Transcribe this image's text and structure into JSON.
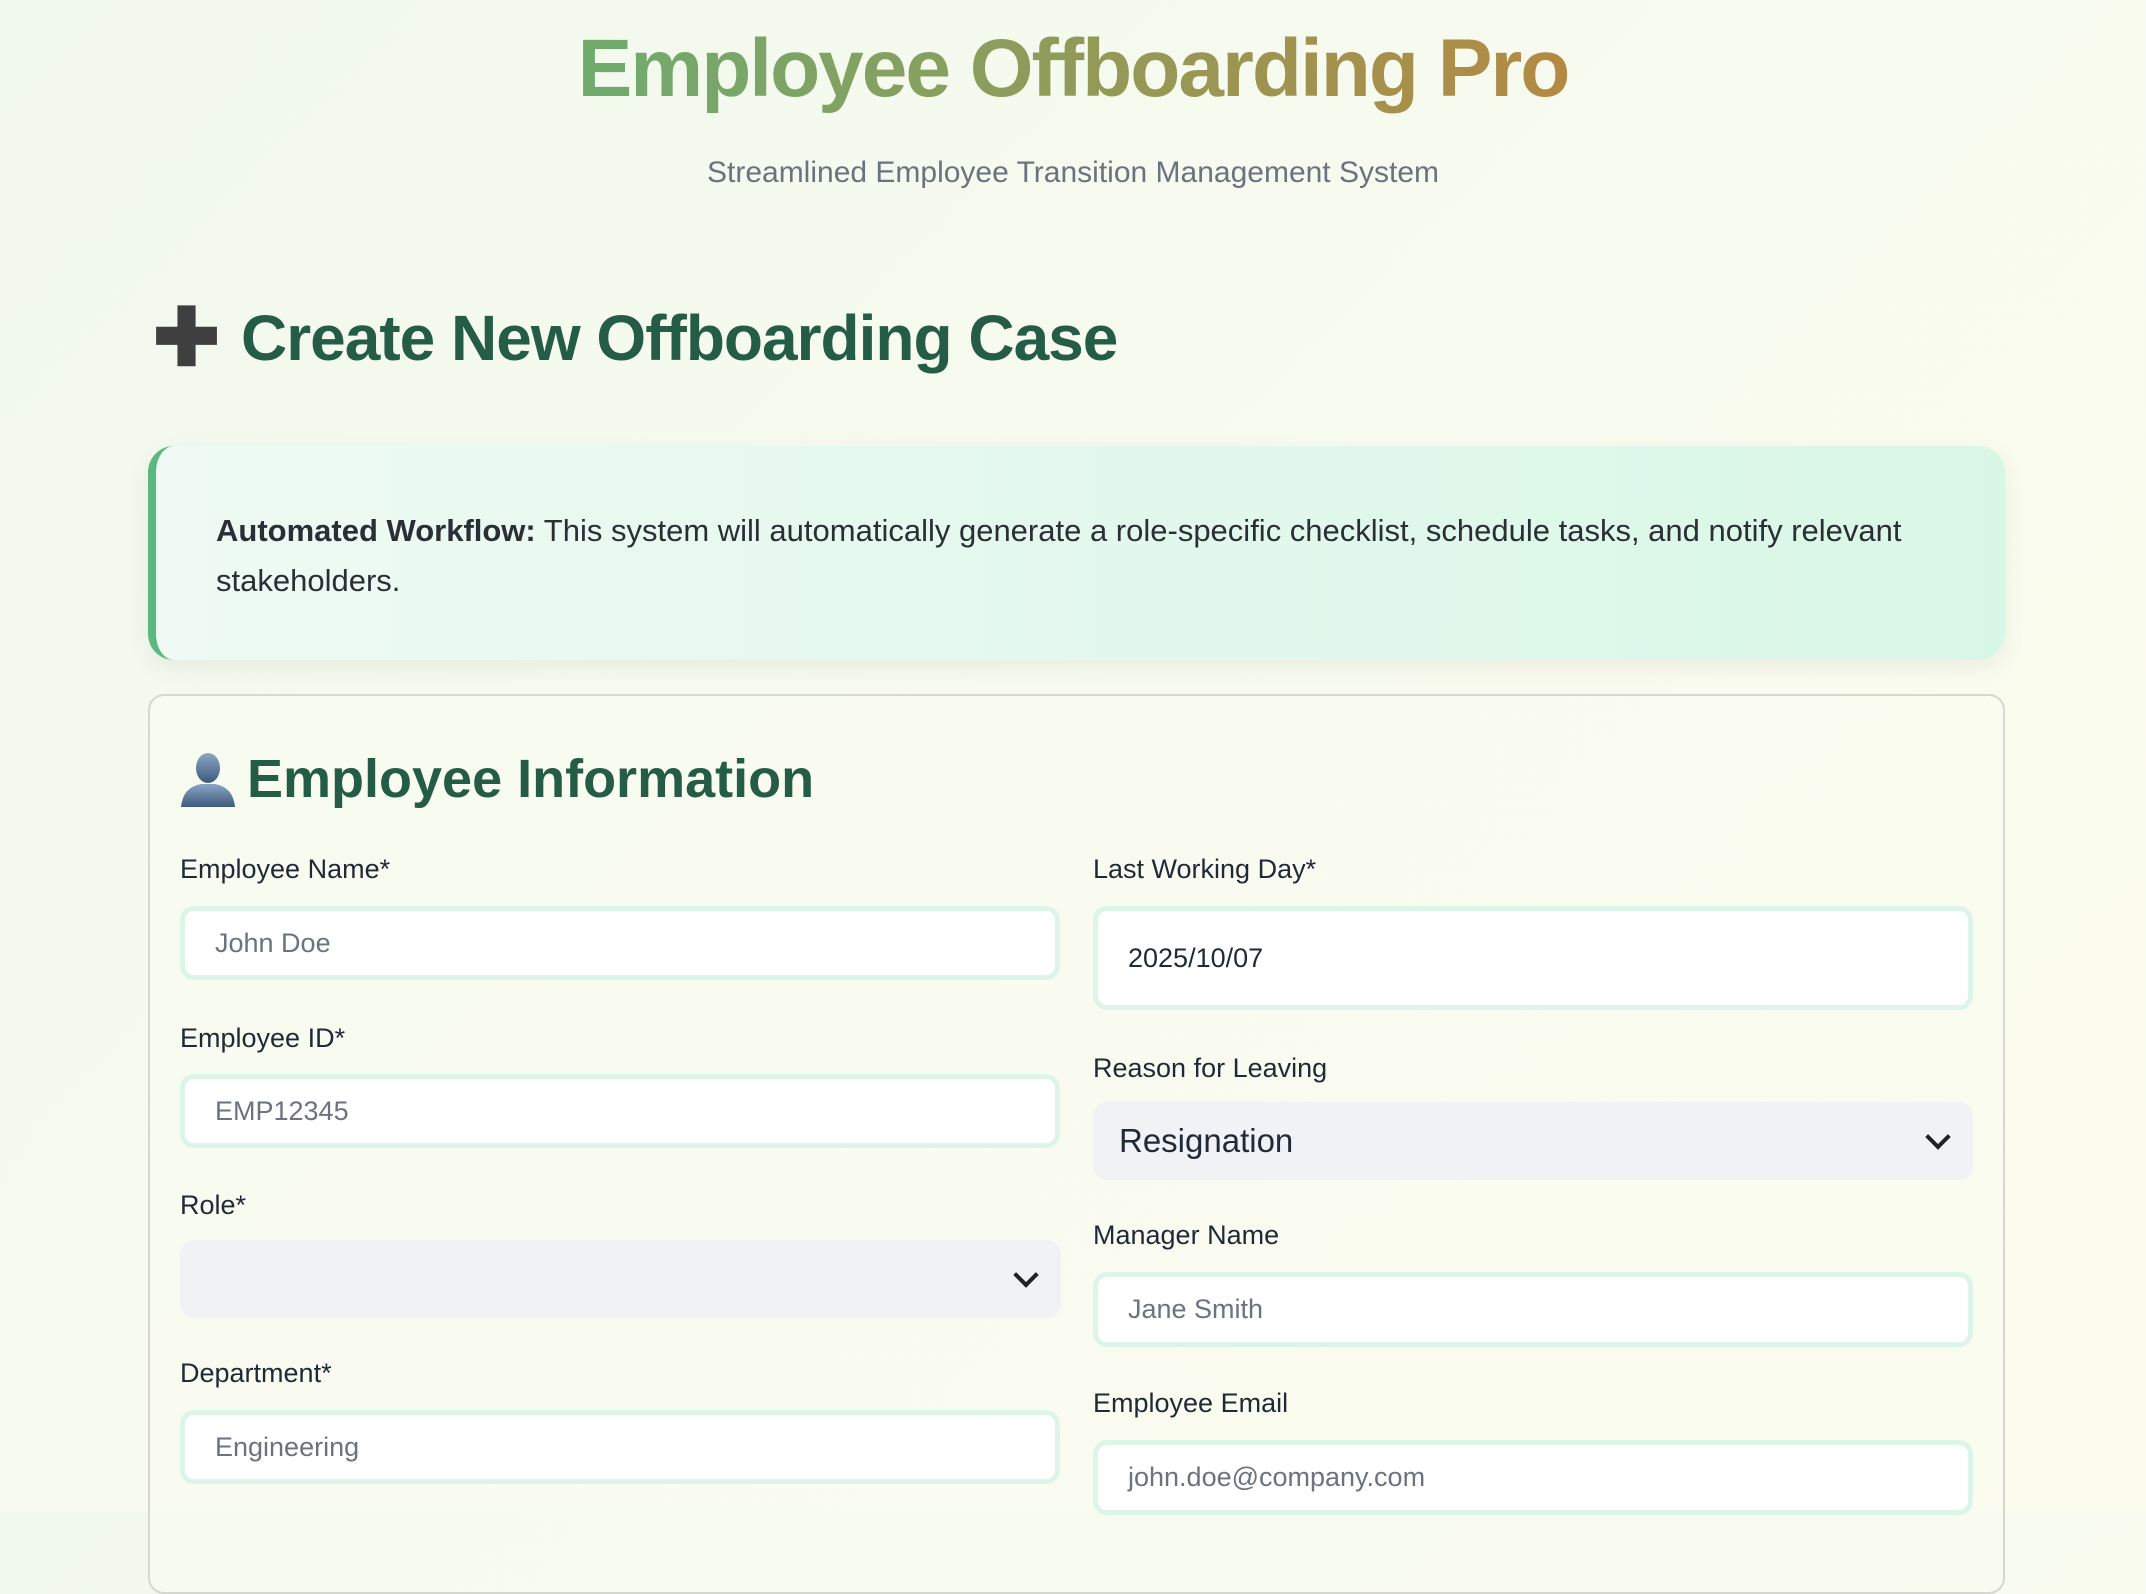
{
  "header": {
    "title": "Employee Offboarding Pro",
    "subtitle": "Streamlined Employee Transition Management System"
  },
  "page": {
    "heading_icon": "plus-icon",
    "heading": "Create New Offboarding Case"
  },
  "info": {
    "bold": "Automated Workflow:",
    "text": " This system will automatically generate a role-specific checklist, schedule tasks, and notify relevant stakeholders."
  },
  "section": {
    "icon": "user-silhouette-icon",
    "title": "Employee Information"
  },
  "form": {
    "employee_name": {
      "label": "Employee Name*",
      "placeholder": "John Doe"
    },
    "employee_id": {
      "label": "Employee ID*",
      "placeholder": "EMP12345"
    },
    "role": {
      "label": "Role*",
      "value": ""
    },
    "department": {
      "label": "Department*",
      "placeholder": "Engineering"
    },
    "last_working_day": {
      "label": "Last Working Day*",
      "value": "2025/10/07"
    },
    "reason": {
      "label": "Reason for Leaving",
      "value": "Resignation"
    },
    "manager_name": {
      "label": "Manager Name",
      "placeholder": "Jane Smith"
    },
    "employee_email": {
      "label": "Employee Email",
      "placeholder": "john.doe@company.com"
    }
  },
  "colors": {
    "primary": "#245c45",
    "accent": "#5cb883",
    "title_gradient_start": "#6fab6e",
    "title_gradient_end": "#b38a44"
  }
}
